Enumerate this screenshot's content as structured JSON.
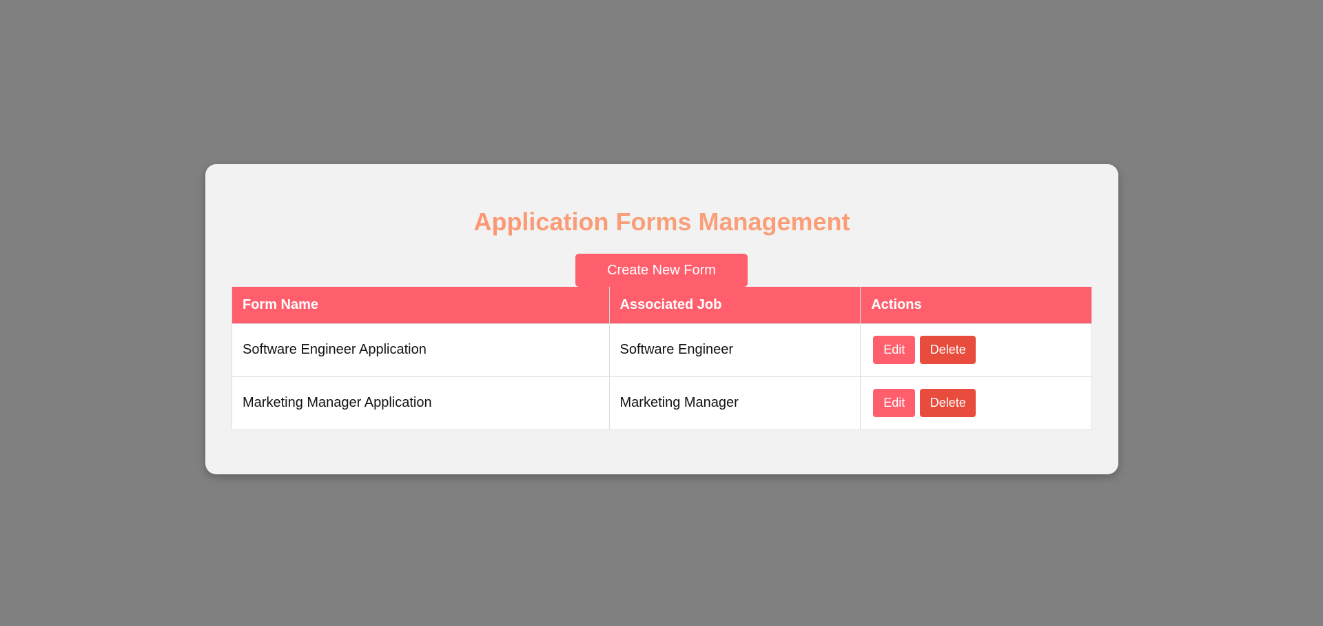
{
  "page": {
    "title": "Application Forms Management",
    "create_button_label": "Create New Form"
  },
  "table": {
    "headers": [
      "Form Name",
      "Associated Job",
      "Actions"
    ],
    "rows": [
      {
        "form_name": "Software Engineer Application",
        "job": "Software Engineer",
        "edit_label": "Edit",
        "delete_label": "Delete"
      },
      {
        "form_name": "Marketing Manager Application",
        "job": "Marketing Manager",
        "edit_label": "Edit",
        "delete_label": "Delete"
      }
    ]
  },
  "colors": {
    "background": "#808080",
    "card": "#f2f2f2",
    "accent": "#ff5f6d",
    "title": "#f8a07a",
    "delete": "#e74c3c"
  }
}
